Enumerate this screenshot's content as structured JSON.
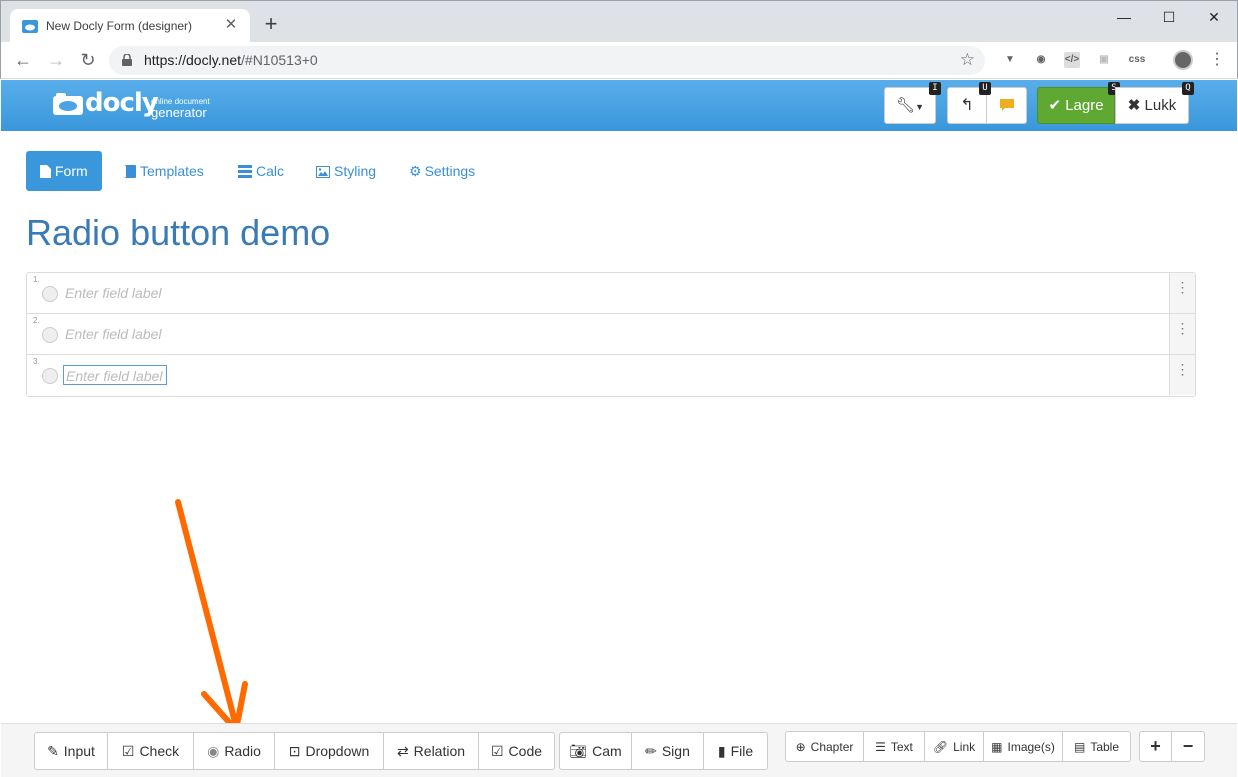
{
  "browser": {
    "tab_title": "New Docly Form (designer)",
    "url_host": "https://docly.net",
    "url_path": "/#N10513+0",
    "ext_css_label": "css"
  },
  "app": {
    "logo_word": "docly",
    "logo_sub_top": "online document",
    "logo_sub_bottom": "generator",
    "shortcut_tools": "I",
    "shortcut_undo": "U",
    "shortcut_save": "S",
    "shortcut_close": "Q",
    "save_label": "Lagre",
    "close_label": "Lukk",
    "accent_color": "#3a97db",
    "save_color": "#5fa832"
  },
  "nav": {
    "tabs": [
      {
        "label": "Form",
        "icon": "file-icon"
      },
      {
        "label": "Templates",
        "icon": "book-icon"
      },
      {
        "label": "Calc",
        "icon": "server-icon"
      },
      {
        "label": "Styling",
        "icon": "image-icon"
      },
      {
        "label": "Settings",
        "icon": "gear-icon"
      }
    ]
  },
  "page": {
    "title": "Radio button demo"
  },
  "fields": [
    {
      "number": "1.",
      "placeholder": "Enter field label"
    },
    {
      "number": "2.",
      "placeholder": "Enter field label"
    },
    {
      "number": "3.",
      "placeholder": "Enter field label"
    }
  ],
  "bottom_toolbar": {
    "group1": [
      "Input",
      "Check",
      "Radio",
      "Dropdown",
      "Relation",
      "Code"
    ],
    "group2": [
      "Cam",
      "Sign",
      "File"
    ],
    "group3": [
      "Chapter",
      "Text",
      "Link",
      "Image(s)",
      "Table"
    ],
    "zoom_in": "+",
    "zoom_out": "−"
  }
}
